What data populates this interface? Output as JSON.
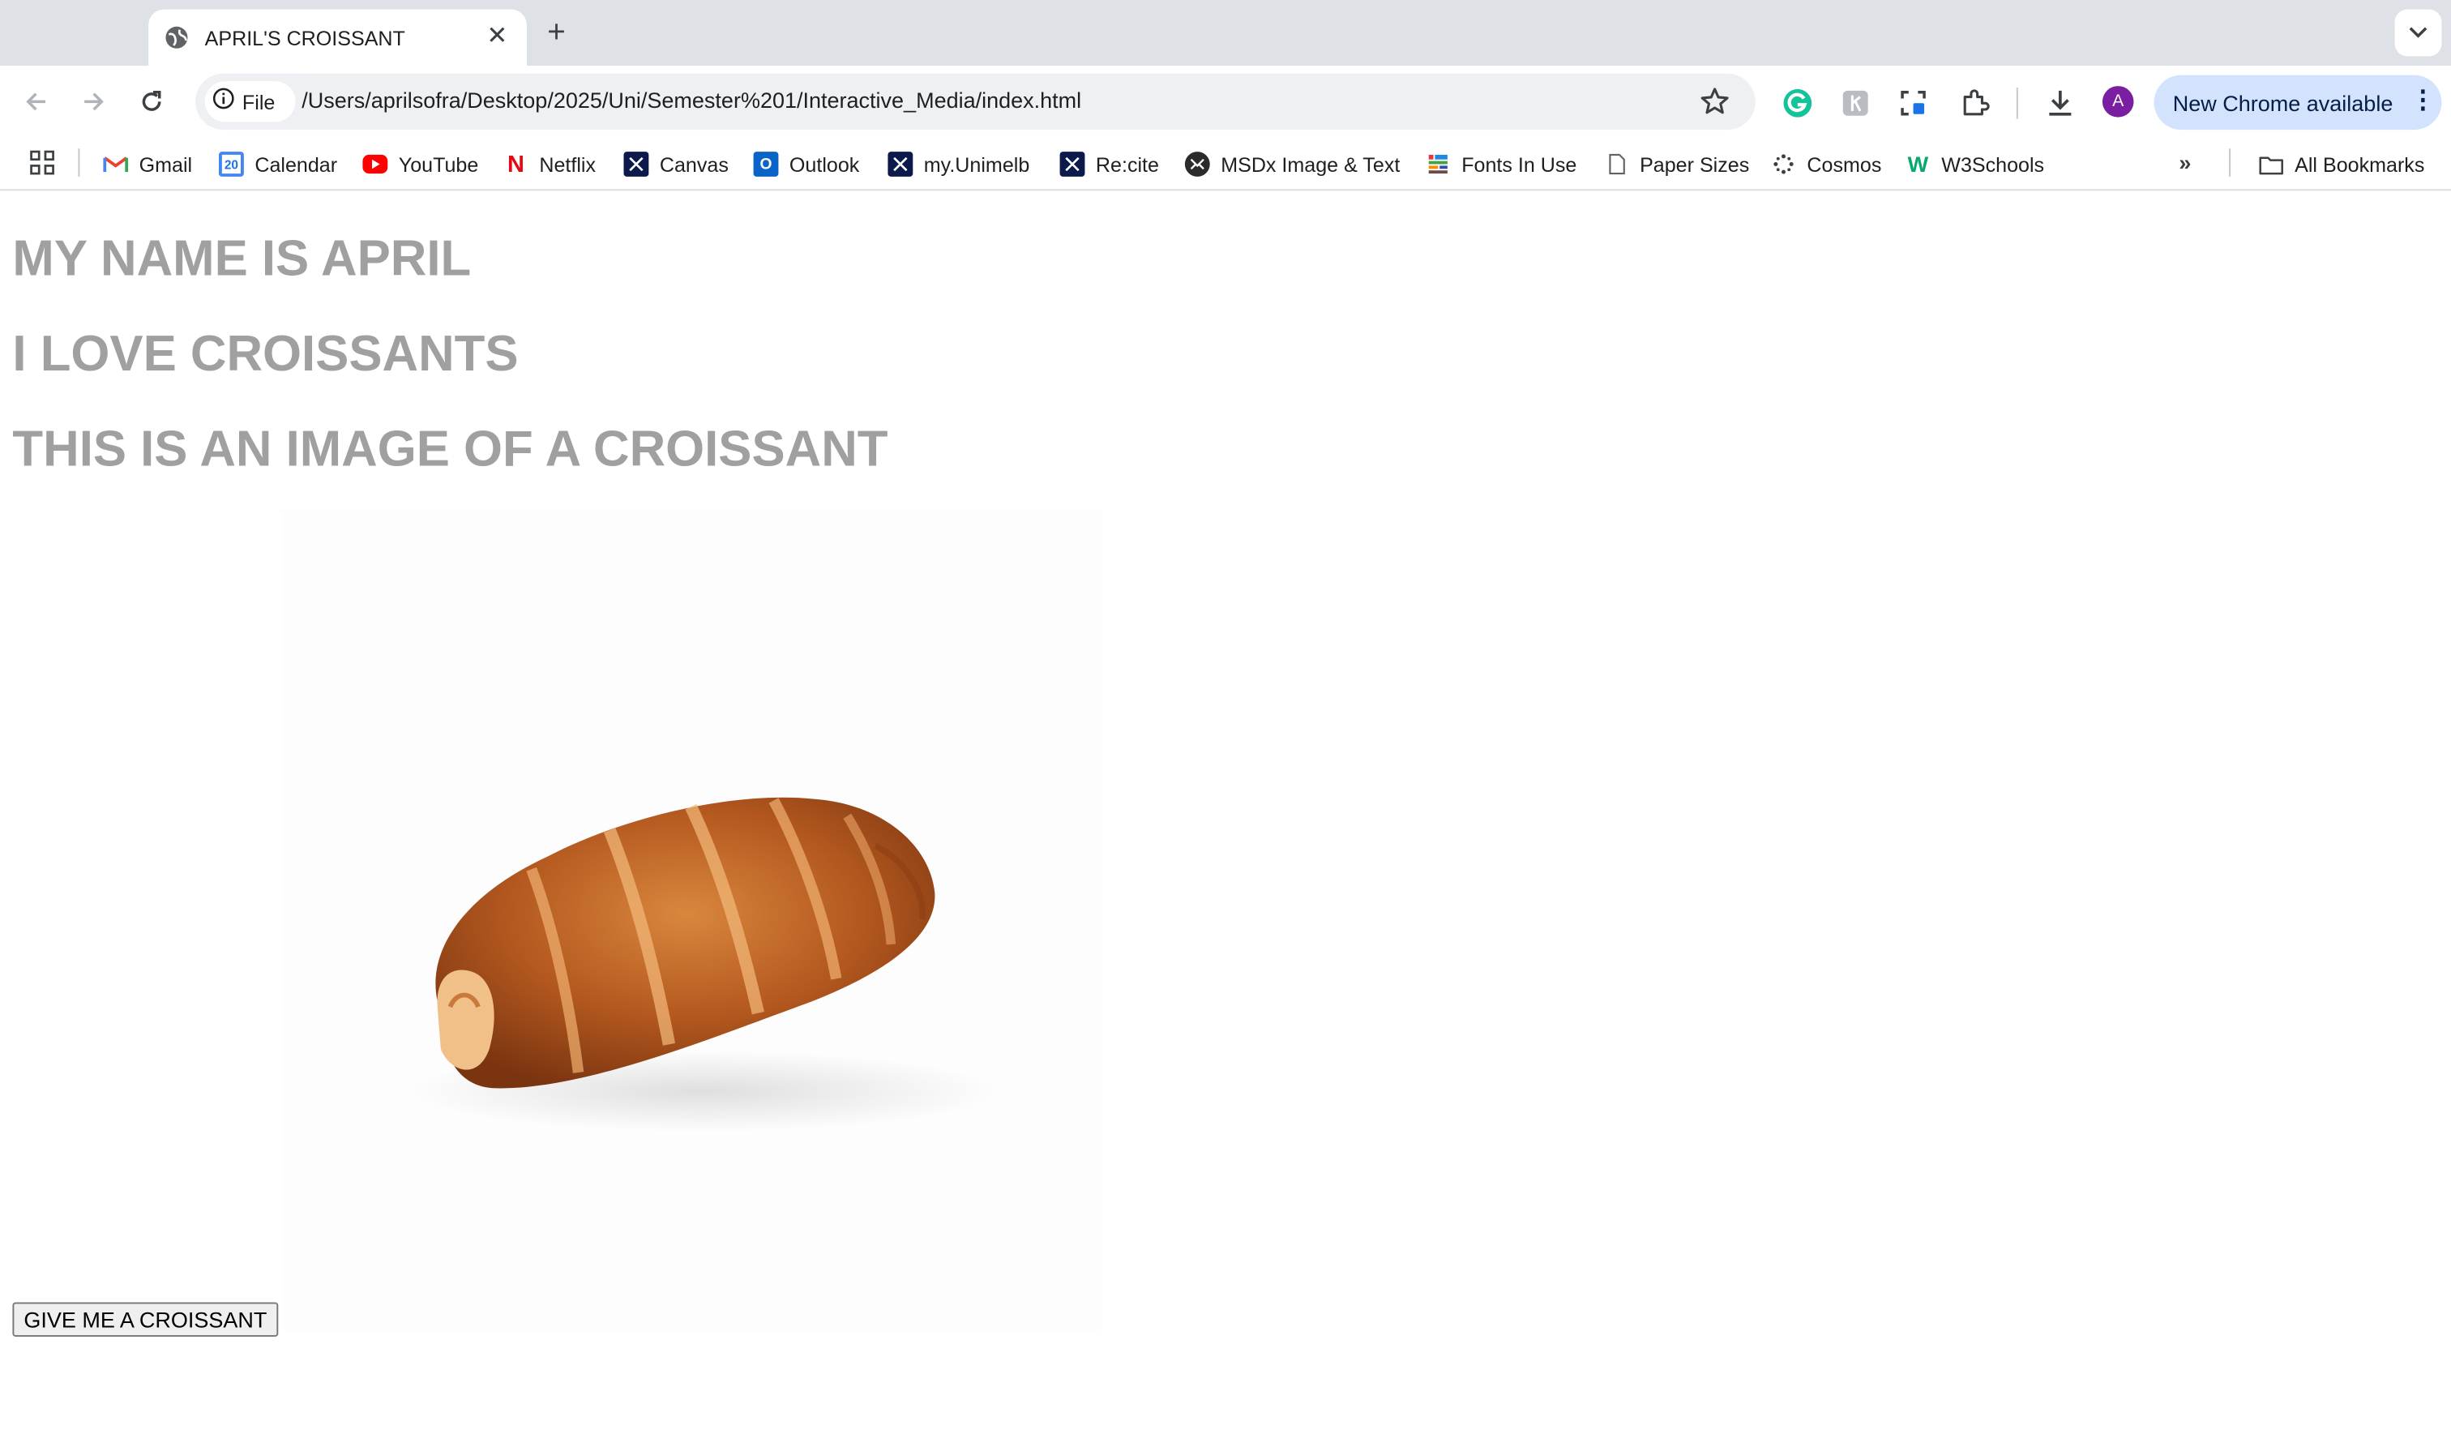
{
  "browser": {
    "tab": {
      "title": "APRIL'S CROISSANT"
    },
    "omnibox": {
      "chip_label": "File",
      "url": "/Users/aprilsofra/Desktop/2025/Uni/Semester%201/Interactive_Media/index.html"
    },
    "profile_initial": "A",
    "update_label": "New Chrome available",
    "bookmarks": [
      {
        "label": "Gmail",
        "icon": "gmail-icon"
      },
      {
        "label": "Calendar",
        "icon": "calendar-icon",
        "icon_text": "20"
      },
      {
        "label": "YouTube",
        "icon": "youtube-icon"
      },
      {
        "label": "Netflix",
        "icon": "netflix-icon",
        "icon_text": "N"
      },
      {
        "label": "Canvas",
        "icon": "unimelb-icon"
      },
      {
        "label": "Outlook",
        "icon": "outlook-icon",
        "icon_text": "O"
      },
      {
        "label": "my.Unimelb",
        "icon": "unimelb-icon"
      },
      {
        "label": "Re:cite",
        "icon": "unimelb-icon"
      },
      {
        "label": "MSDx Image & Text",
        "icon": "msdx-icon"
      },
      {
        "label": "Fonts In Use",
        "icon": "fonts-in-use-icon"
      },
      {
        "label": "Paper Sizes",
        "icon": "page-icon"
      },
      {
        "label": "Cosmos",
        "icon": "cosmos-icon"
      },
      {
        "label": "W3Schools",
        "icon": "w3schools-icon",
        "icon_text": "W"
      }
    ],
    "all_bookmarks_label": "All Bookmarks",
    "colors": {
      "tabstrip": "#dee1e6",
      "omnibox": "#eef0f3",
      "update_chip": "#d3e3fd",
      "avatar": "#7b1fa2"
    }
  },
  "page": {
    "headings": [
      "MY NAME IS APRIL",
      "I LOVE CROISSANTS",
      "THIS IS AN IMAGE OF A CROISSANT"
    ],
    "image_subject": "croissant",
    "button_label": "GIVE ME A CROISSANT",
    "colors": {
      "heading": "#a0a0a0"
    }
  }
}
